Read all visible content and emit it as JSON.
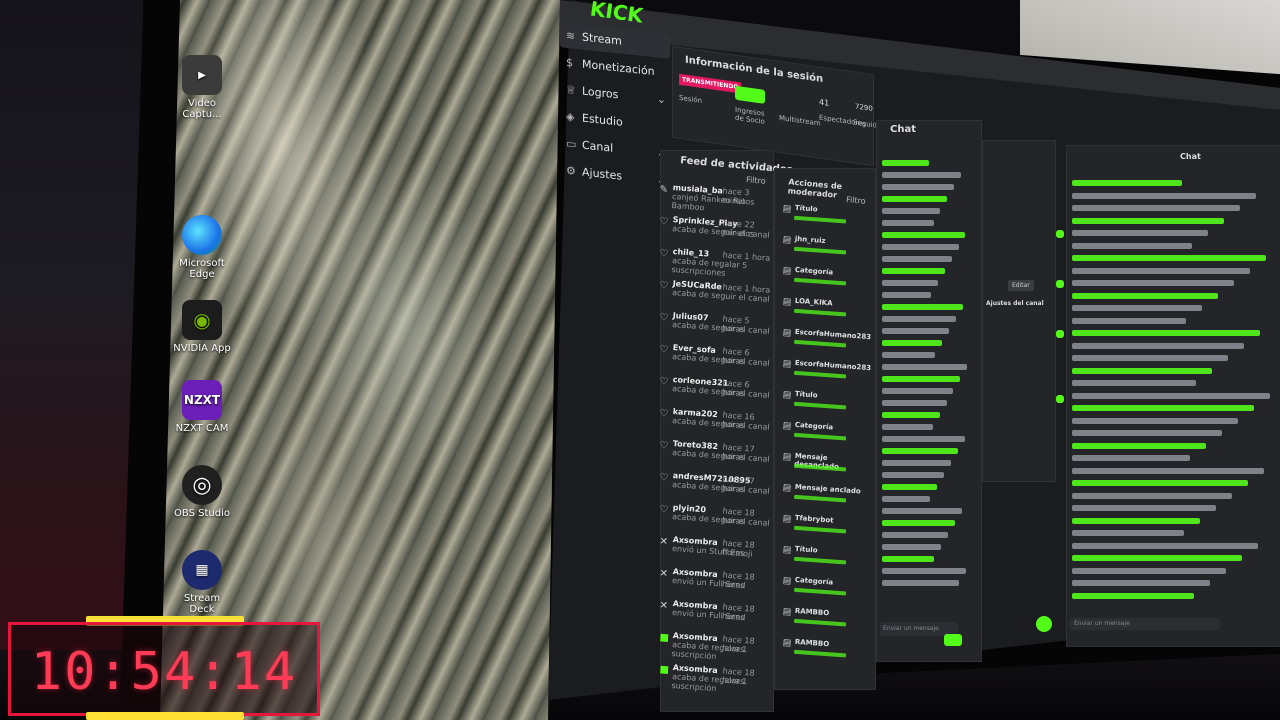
{
  "desktop": {
    "icons": [
      {
        "label": "Video Captu..."
      },
      {
        "label": "Microsoft Edge"
      },
      {
        "label": "NVIDIA App"
      },
      {
        "label": "NZXT CAM"
      },
      {
        "label": "OBS Studio"
      },
      {
        "label": "Stream Deck"
      }
    ]
  },
  "kick": {
    "logo": "KICK",
    "sidebar": [
      {
        "label": "Stream"
      },
      {
        "label": "Monetización"
      },
      {
        "label": "Logros"
      },
      {
        "label": "Estudio"
      },
      {
        "label": "Canal"
      },
      {
        "label": "Ajustes"
      }
    ],
    "session": {
      "title": "Información de la sesión",
      "status_badge": "TRANSMITIENDO",
      "items": [
        "Sesión",
        "Ingresos de Socio",
        "Multistream",
        "Espectadores",
        "Seguid..."
      ],
      "viewers": "41",
      "followers": "7290"
    },
    "feed": {
      "title": "Feed de actividades",
      "filter": "Filtro",
      "rows": [
        {
          "name": "musiala_ba",
          "text": "canjeó Rankeo Rio Bamboo",
          "time": "hace 3 minutos"
        },
        {
          "name": "Sprinklez_Play",
          "text": "acaba de seguir el canal",
          "time": "hace 22 minutos"
        },
        {
          "name": "chile_13",
          "text": "acaba de regalar 5 suscripciones",
          "time": "hace 1 hora"
        },
        {
          "name": "JeSUCaRde",
          "text": "acaba de seguir el canal",
          "time": "hace 1 hora"
        },
        {
          "name": "Julius07",
          "text": "acaba de seguir el canal",
          "time": "hace 5 horas"
        },
        {
          "name": "Ever_sofa",
          "text": "acaba de seguir el canal",
          "time": "hace 6 horas"
        },
        {
          "name": "corleone321",
          "text": "acaba de seguir el canal",
          "time": "hace 6 horas"
        },
        {
          "name": "karma202",
          "text": "acaba de seguir el canal",
          "time": "hace 16 horas"
        },
        {
          "name": "Toreto382",
          "text": "acaba de seguir el canal",
          "time": "hace 17 horas"
        },
        {
          "name": "andresM7210895",
          "text": "acaba de seguir el canal",
          "time": "hace 17 horas"
        },
        {
          "name": "plyin20",
          "text": "acaba de seguir el canal",
          "time": "hace 18 horas"
        },
        {
          "name": "Axsombra",
          "text": "envió un Stuff Emoji",
          "time": "hace 18 horas"
        },
        {
          "name": "Axsombra",
          "text": "envió un Full Send",
          "time": "hace 18 horas"
        },
        {
          "name": "Axsombra",
          "text": "envió un Full Send",
          "time": "hace 18 horas"
        },
        {
          "name": "Axsombra",
          "text": "acaba de regalar 1 suscripción",
          "time": "hace 18 horas"
        },
        {
          "name": "Axsombra",
          "text": "acaba de regalar 1 suscripción",
          "time": "hace 18 horas"
        }
      ]
    },
    "mod_actions": {
      "title": "Acciones de moderador",
      "filter": "Filtro",
      "rows": [
        {
          "name": "Título"
        },
        {
          "name": "jhn_ruiz"
        },
        {
          "name": "Categoría"
        },
        {
          "name": "LOA_KIKA"
        },
        {
          "name": "EscorfaHumano283"
        },
        {
          "name": "EscorfaHumano283"
        },
        {
          "name": "Título"
        },
        {
          "name": "Categoría"
        },
        {
          "name": "Mensaje desanclado"
        },
        {
          "name": "Mensaje anclado"
        },
        {
          "name": "Tfabrybot"
        },
        {
          "name": "Título"
        },
        {
          "name": "Categoría"
        },
        {
          "name": "RAMBBO"
        },
        {
          "name": "RAMBBO"
        }
      ]
    },
    "chat": {
      "title": "Chat",
      "input_placeholder": "Enviar un mensaje",
      "chat_settings_label": "Ajustes del canal",
      "edit_label": "Editar"
    },
    "right_chat": {
      "title": "Chat",
      "input_placeholder": "Enviar un mensaje"
    }
  },
  "overlay_clock": {
    "time": "10:54:14"
  }
}
